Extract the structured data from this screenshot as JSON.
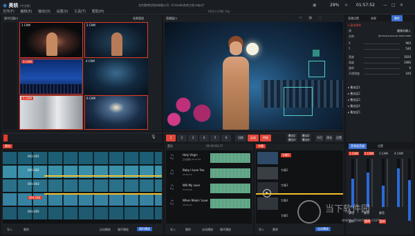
{
  "app": {
    "logo": "奥轶",
    "edition": "(专业版)",
    "company": "北京奥特拉科技有限公司",
    "file": "E:\\mobi\\合成工程.mbprj*",
    "menu": [
      "文件(F)",
      "编辑(E)",
      "输出(O)",
      "设置(S)",
      "工具(T)",
      "帮助(H)"
    ],
    "stats": {
      "res": "1920×1080 30p",
      "pct": "29%",
      "clock": "01:57:52"
    }
  },
  "preview": {
    "title": "源节目窗口",
    "right_label": "场景管理"
  },
  "program": {
    "title": "直播窗口"
  },
  "sources": [
    {
      "label": "1 CAM"
    },
    {
      "label": "2 CAM"
    },
    {
      "label": "3 CAM"
    },
    {
      "label": "4 CAM"
    },
    {
      "label": "5 CAM"
    },
    {
      "label": "6 CAM"
    }
  ],
  "switcher": {
    "buttons": [
      "1",
      "2",
      "3",
      "4",
      "5",
      "6"
    ],
    "cut": "切换",
    "auto": "自动",
    "fx": "特效",
    "extra": [
      "叠加1",
      "叠加2",
      "叠加3",
      "叠加4"
    ],
    "right_btns": [
      "节目",
      "预览",
      "设置"
    ]
  },
  "props": {
    "tabs": [
      "直播设置",
      "效果",
      "属性"
    ],
    "section": "基本属性",
    "rows": [
      {
        "k": "源",
        "v": "摄像机输入"
      },
      {
        "k": "名称",
        "v": "[Portrait] [Camera] 1920×1080"
      },
      {
        "k": "X",
        "v": "960"
      },
      {
        "k": "Y",
        "v": "540"
      },
      {
        "k": "宽度",
        "v": "1920"
      },
      {
        "k": "高度",
        "v": "1080"
      },
      {
        "k": "旋转",
        "v": "0"
      },
      {
        "k": "不透明度",
        "v": "100"
      }
    ],
    "groups": [
      "叠加层1",
      "叠加层2",
      "叠加层3",
      "叠加层4",
      "叠加层5"
    ]
  },
  "timeline": {
    "left_title": "素材",
    "center_title": "音乐",
    "right_title": "字幕",
    "tracks": [
      "001-001",
      "001-002",
      "001-003",
      "001-004",
      "001-005"
    ],
    "music": [
      {
        "name": "Holy Virgin",
        "meta": "正在播放 00:03:52"
      },
      {
        "name": "Baby I Love You",
        "meta": "00:04:12"
      },
      {
        "name": "Will My Love",
        "meta": "00:03:48"
      },
      {
        "name": "When Makin' Love",
        "meta": "00:04:01"
      }
    ],
    "subs": [
      "字幕1",
      "字幕2",
      "字幕3",
      "字幕4",
      "字幕5"
    ],
    "timecode": "00:00:00:27",
    "bottom_left": [
      "导入",
      "删除"
    ],
    "bottom_center": [
      "导入",
      "删除",
      "自动播放",
      "循环播放",
      "随机播放"
    ],
    "bottom_right": [
      "导入",
      "删除",
      "自动播放",
      "循环播放"
    ]
  },
  "mixer": {
    "tabs": [
      "音频混音器",
      "设置"
    ],
    "channels": [
      "1 CAM",
      "2 CAM",
      "3 CAM",
      "4 CAM"
    ],
    "mute": "静音",
    "solo": "监听"
  },
  "watermark": {
    "cn": "当下软件园",
    "url": "www.downxia.com"
  }
}
